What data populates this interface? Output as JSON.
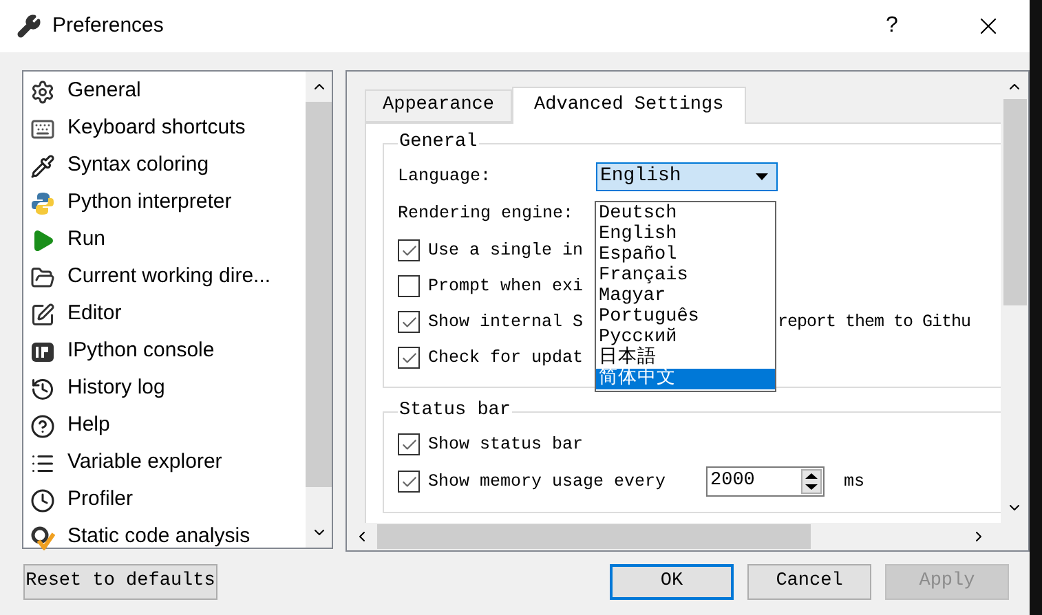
{
  "window": {
    "title": "Preferences",
    "help": "?"
  },
  "sidebar": {
    "items": [
      {
        "label": "General"
      },
      {
        "label": "Keyboard shortcuts"
      },
      {
        "label": "Syntax coloring"
      },
      {
        "label": "Python interpreter"
      },
      {
        "label": "Run"
      },
      {
        "label": "Current working dire..."
      },
      {
        "label": "Editor"
      },
      {
        "label": "IPython console"
      },
      {
        "label": "History log"
      },
      {
        "label": "Help"
      },
      {
        "label": "Variable explorer"
      },
      {
        "label": "Profiler"
      },
      {
        "label": "Static code analysis"
      }
    ]
  },
  "tabs": [
    {
      "label": "Appearance",
      "selected": false
    },
    {
      "label": "Advanced Settings",
      "selected": true
    }
  ],
  "general": {
    "title": "General",
    "language": {
      "label": "Language:",
      "value": "English"
    },
    "rendering_engine": {
      "label": "Rendering engine:"
    },
    "checkboxes": [
      {
        "label": "Use a single in",
        "checked": true
      },
      {
        "label": "Prompt when exi",
        "checked": false
      },
      {
        "label": "Show internal S",
        "label_after": "report them to Githu",
        "checked": true
      },
      {
        "label": "Check for updat",
        "checked": true
      }
    ]
  },
  "language_dropdown": {
    "options": [
      {
        "label": "Deutsch",
        "selected": false
      },
      {
        "label": "English",
        "selected": false
      },
      {
        "label": "Español",
        "selected": false
      },
      {
        "label": "Français",
        "selected": false
      },
      {
        "label": "Magyar",
        "selected": false
      },
      {
        "label": "Português",
        "selected": false
      },
      {
        "label": "Русский",
        "selected": false
      },
      {
        "label": "日本語",
        "selected": false
      },
      {
        "label": "简体中文",
        "selected": true
      }
    ]
  },
  "status_bar": {
    "title": "Status bar",
    "checkboxes": [
      {
        "label": "Show status bar",
        "checked": true
      }
    ],
    "memory": {
      "label": "Show memory usage every",
      "checked": true,
      "value": "2000",
      "unit": "ms"
    }
  },
  "buttons": {
    "reset": {
      "label": "Reset to defaults"
    },
    "ok": {
      "label": "OK"
    },
    "cancel": {
      "label": "Cancel"
    },
    "apply": {
      "label": "Apply",
      "disabled": true
    }
  }
}
